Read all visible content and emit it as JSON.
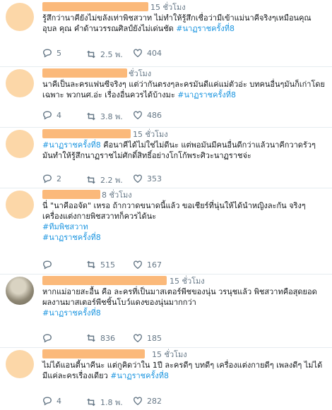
{
  "tweets": [
    {
      "time": "15 ชั่วโมง",
      "text": "รู้สึกว่านาคียังไม่ขลังเท่าพิชสวาท ไม่ทำให้รู้สึกเชื่อว่ามีเข้าแม่นาคีจริงๆเหมือนคุณอุบล คุณ คำด้านวรรณศิลป์ยังไม่เด่นชัด",
      "hashtag": "#นาฏราชครั้งที่8",
      "replies": "5",
      "retweets": "2.5 พ.",
      "likes": "404"
    },
    {
      "time": "ชั่วโมง",
      "text": "นาคีเป็นละครแฟนซีจริงๆ แต่ว่ากันตรงๆละครมันดีแค่แม่ตัวอ่ะ บทคนอื่นๆมันก็เก่าโดยเฉพาะ พวกนศ.อ่ะ เรื่องอื่นควรได้บ้างมะ",
      "hashtag": "#นาฏราชครั้งที่8",
      "replies": "4",
      "retweets": "3.8 พ.",
      "likes": "486"
    },
    {
      "time": "15 ชั่วโมง",
      "text": "คือนาคีได้ไม่ใช่ไม่ดีนะ แต่พอมันมีคนอื่นดีกว่าแล้วนาคีกวาดรัวๆมันทำให้รู้สึกนาฏราชไม่ศักดิ์สิทธิ์อย่างโกโก้พระศิวะนาฏราชจ่ะ",
      "hashtag": "#นาฏราชครั้งที่8",
      "replies": "2",
      "retweets": "2.2 พ.",
      "likes": "353"
    },
    {
      "time": "8 ชั่วโมง",
      "text": "นี่ \"นาคีออจัด\" เหรอ ถ้ากวาดขนาดนี้แล้ว ขอเชียร์ที่นุ่นให้ได้นำหญิงละกัน จริงๆเครื่องแต่งกายพิชสวาทก็ควรได้นะ",
      "hashtag": "#ทีมพิชสวาท",
      "hashtag2": "#นาฏราชครั้งที่8",
      "replies": "",
      "retweets": "515",
      "likes": "167"
    },
    {
      "time": "15 ชั่วโมง",
      "text": "หากแม่อายสะอื้น คือ ละครที่เป็นมาสเตอร์พีชของนุ่น วรนุชแล้ว พิชสวาทคือสุดยอดผลงานมาสเตอร์พีชชิ้นโบว์แดงของนุ่นมากกว่า",
      "hashtag": "#นาฏราชครั้งที่8",
      "replies": "",
      "retweets": "836",
      "likes": "185"
    },
    {
      "time": "15 ชั่วโมง",
      "text": "ไม่ได้แอนตี้นาคีนะ แต่กูคิดว่าใน 1ปี ละครดีๆ บทดีๆ เครื่องแต่งกายดีๆ เพลงดีๆ ไม่ได้มีแค่ละครเรื่องเดียว",
      "hashtag": "#นาฏราชครั้งที่8",
      "replies": "4",
      "retweets": "1.8 พ.",
      "likes": "282"
    }
  ]
}
